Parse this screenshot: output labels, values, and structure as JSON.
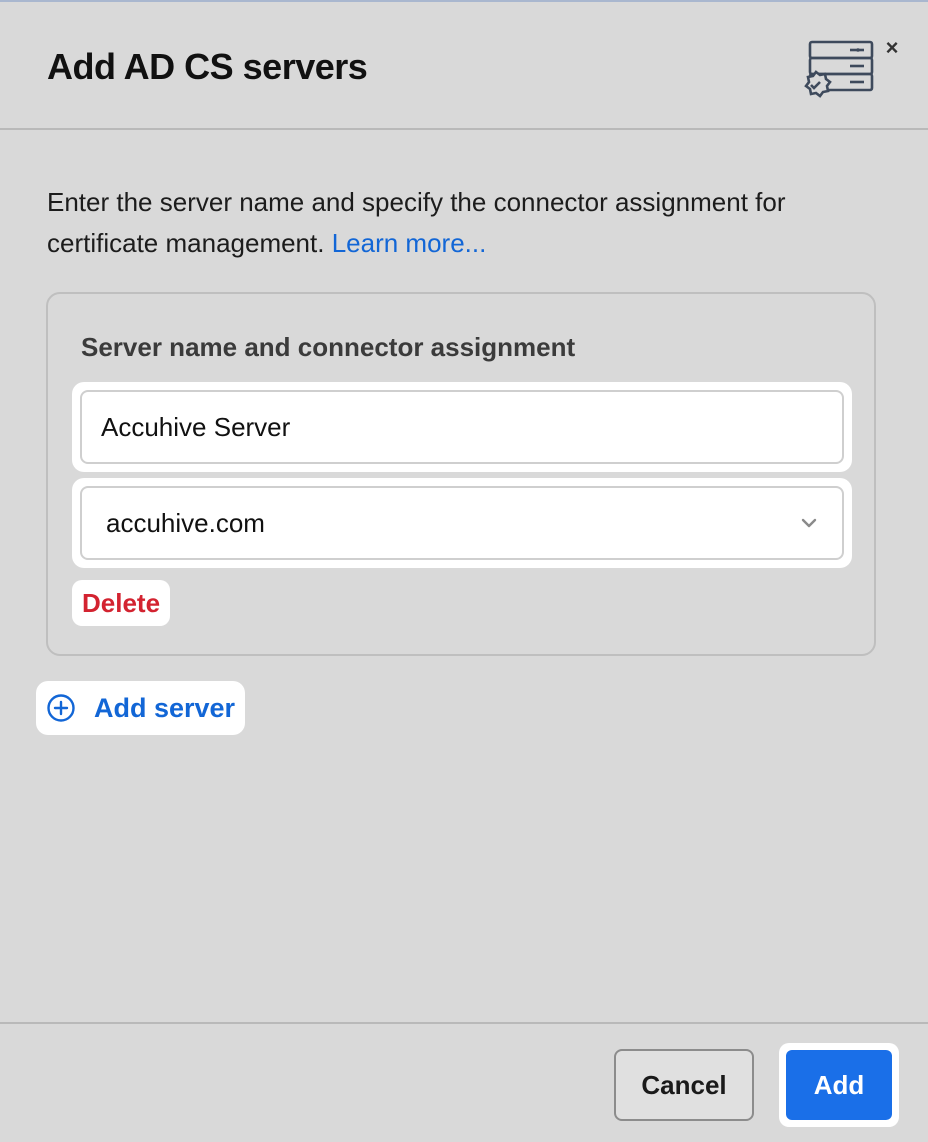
{
  "dialog": {
    "title": "Add AD CS servers",
    "close_label": "×",
    "header_icon": "server-certificate-icon"
  },
  "description": {
    "text": "Enter the server name and specify the connector assignment for certificate management.",
    "link_label": "Learn more..."
  },
  "server_card": {
    "label": "Server name and connector assignment",
    "server_name_value": "Accuhive Server",
    "connector_selected": "accuhive.com",
    "delete_label": "Delete"
  },
  "add_server_label": "Add server",
  "footer": {
    "cancel_label": "Cancel",
    "add_label": "Add"
  },
  "colors": {
    "accent": "#1a6fe8",
    "link": "#1266d6",
    "danger": "#d32330",
    "background": "#d9d9d9"
  }
}
